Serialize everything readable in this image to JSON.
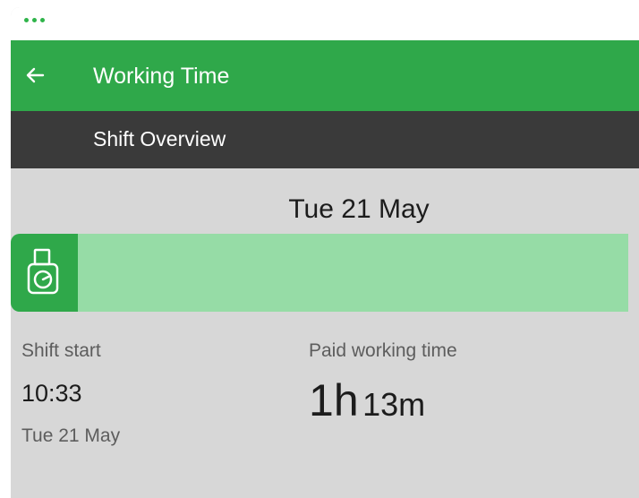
{
  "app_bar": {
    "title": "Working Time",
    "back_icon": "arrow-left-icon"
  },
  "sub_bar": {
    "title": "Shift Overview"
  },
  "overview": {
    "date": "Tue 21 May",
    "clock_icon": "tachograph-clock-icon",
    "shift_start": {
      "label": "Shift start",
      "time": "10:33",
      "date": "Tue 21 May"
    },
    "paid_working_time": {
      "label": "Paid working time",
      "hours": "1",
      "hours_unit": "h",
      "minutes": "13",
      "minutes_unit": "m"
    }
  },
  "colors": {
    "primary_green": "#2fa84a",
    "timeline_green": "#96dca6",
    "sub_bar": "#3a3a3a",
    "background": "#d7d7d7"
  }
}
